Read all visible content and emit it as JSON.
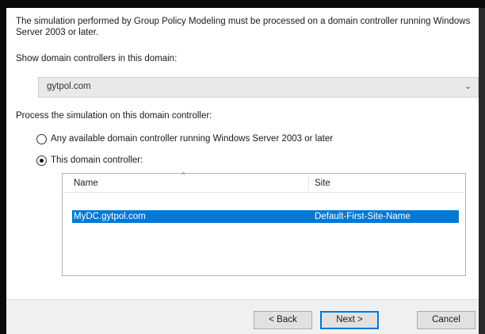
{
  "intro_text": "The simulation performed by Group Policy Modeling must be processed on a domain controller running Windows Server 2003 or later.",
  "domain_section": {
    "label": "Show domain controllers in this domain:",
    "selected_domain": "gytpol.com"
  },
  "process_section": {
    "label": "Process the simulation on this domain controller:",
    "options": [
      {
        "label": "Any available domain controller running Windows Server 2003 or later",
        "checked": false
      },
      {
        "label": "This domain controller:",
        "checked": true
      }
    ]
  },
  "listview": {
    "columns": [
      "Name",
      "Site"
    ],
    "rows": [
      {
        "name": "MyDC.gytpol.com",
        "site": "Default-First-Site-Name",
        "selected": true
      }
    ]
  },
  "buttons": {
    "back": "< Back",
    "next": "Next >",
    "cancel": "Cancel"
  },
  "colors": {
    "selection": "#0078d7",
    "combo_bg": "#e9e9e9"
  }
}
